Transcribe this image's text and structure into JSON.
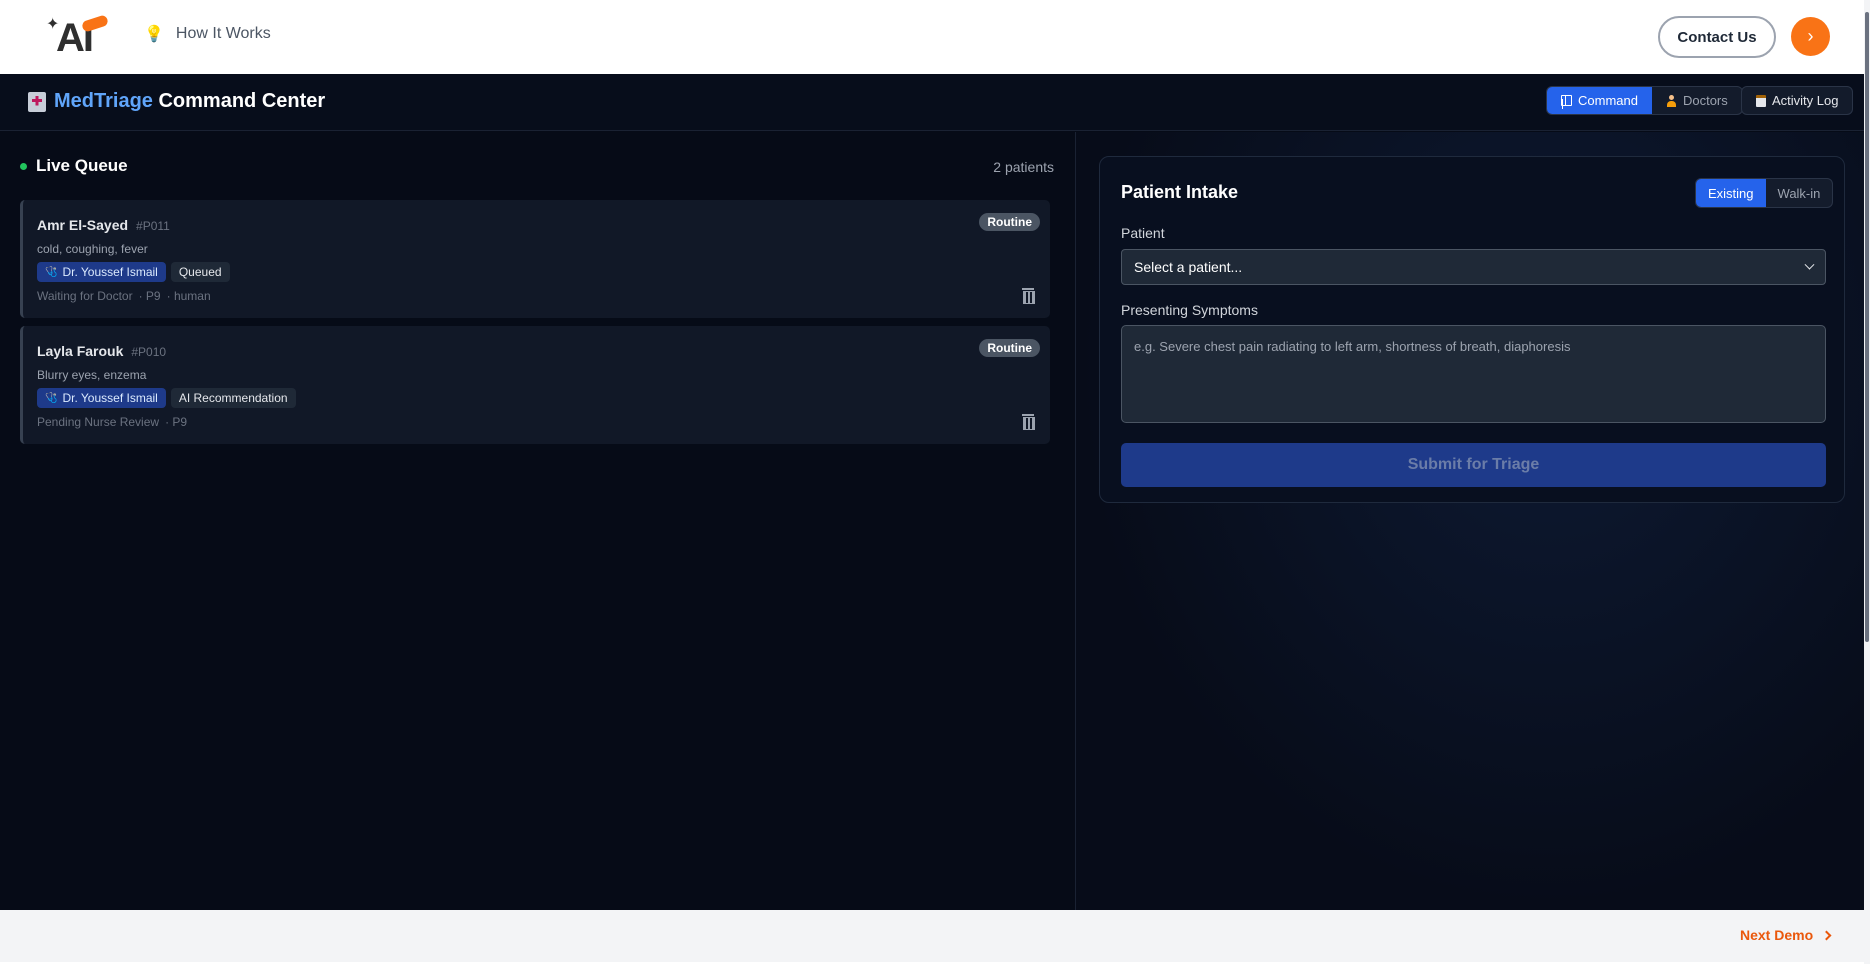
{
  "site": {
    "logo_text": "AI",
    "nav_how": "How It Works",
    "contact": "Contact Us",
    "arrow": "›"
  },
  "app": {
    "brand": "MedTriage",
    "title_rest": " Command Center",
    "nav": {
      "command": "Command",
      "doctors": "Doctors",
      "activity": "Activity Log"
    }
  },
  "queue": {
    "title": "Live Queue",
    "count": "2 patients",
    "patients": [
      {
        "name": "Amr El-Sayed",
        "id": "#P011",
        "symptoms": "cold, coughing, fever",
        "doctor": "Dr. Youssef Ismail",
        "status": "Queued",
        "priority": "Routine",
        "meta_state": "Waiting for Doctor",
        "meta_level": "· P9",
        "meta_source": "· human"
      },
      {
        "name": "Layla Farouk",
        "id": "#P010",
        "symptoms": "Blurry eyes, enzema",
        "doctor": "Dr. Youssef Ismail",
        "status": "AI Recommendation",
        "priority": "Routine",
        "meta_state": "Pending Nurse Review",
        "meta_level": "· P9"
      }
    ]
  },
  "intake": {
    "title": "Patient Intake",
    "mode_existing": "Existing",
    "mode_walkin": "Walk-in",
    "patient_label": "Patient",
    "patient_select": "Select a patient...",
    "symptoms_label": "Presenting Symptoms",
    "symptoms_placeholder": "e.g. Severe chest pain radiating to left arm, shortness of breath, diaphoresis",
    "submit": "Submit for Triage"
  },
  "footer": {
    "next": "Next Demo"
  },
  "colors": {
    "accent": "#2563eb",
    "brand_orange": "#f97316",
    "live": "#22c55e"
  }
}
